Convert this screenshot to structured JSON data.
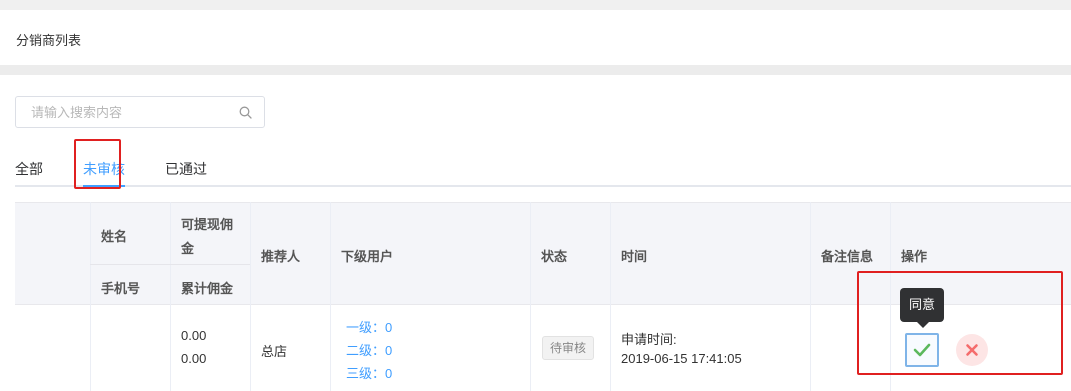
{
  "page": {
    "title": "分销商列表"
  },
  "search": {
    "placeholder": "请输入搜索内容",
    "value": ""
  },
  "tabs": [
    {
      "label": "全部",
      "active": false
    },
    {
      "label": "未审核",
      "active": true
    },
    {
      "label": "已通过",
      "active": false
    }
  ],
  "table": {
    "headers": {
      "name": "姓名",
      "phone": "手机号",
      "withdrawable_l1": "可提现佣",
      "withdrawable_l2": "金",
      "accumulated": "累计佣金",
      "referrer": "推荐人",
      "subordinates": "下级用户",
      "status": "状态",
      "time": "时间",
      "remark": "备注信息",
      "actions": "操作"
    },
    "rows": [
      {
        "name": "",
        "phone": "",
        "withdrawable": "0.00",
        "accumulated": "0.00",
        "referrer": "总店",
        "level1": "一级：0",
        "level2": "二级：0",
        "level3": "三级：0",
        "status": "待审核",
        "time_label": "申请时间:",
        "time_value": "2019-06-15 17:41:05",
        "remark": ""
      }
    ]
  },
  "actions": {
    "agree_tooltip": "同意"
  },
  "colors": {
    "accent": "#409eff",
    "highlight_box": "#e02020",
    "agree_check": "#5cb85c",
    "reject_x": "#f56c6c"
  }
}
